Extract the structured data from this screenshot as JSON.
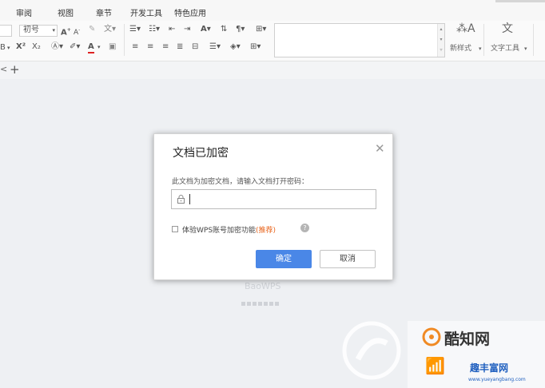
{
  "menu": {
    "items": [
      "审阅",
      "视图",
      "章节",
      "开发工具",
      "特色应用"
    ]
  },
  "toolbar": {
    "font_size": "初号",
    "bold_suffix": "B",
    "superscript": "X²",
    "subscript": "X₂",
    "font_color": "A",
    "new_style": "新样式",
    "text_tools": "文字工具"
  },
  "tabs": {
    "add_label": "+",
    "back_label": "<"
  },
  "background": {
    "brand": "BaoWPS"
  },
  "dialog": {
    "title": "文档已加密",
    "prompt": "此文档为加密文档，请输入文档打开密码：",
    "password_value": "",
    "checkbox_label": "体验WPS账号加密功能",
    "checkbox_badge": "(推荐)",
    "ok_label": "确定",
    "cancel_label": "取消"
  },
  "watermark": {
    "site1": "酷知网",
    "site2": "趣丰富网",
    "url": "www.yueyangbang.com"
  },
  "colors": {
    "accent": "#4a87e7",
    "badge": "#e8641c"
  }
}
